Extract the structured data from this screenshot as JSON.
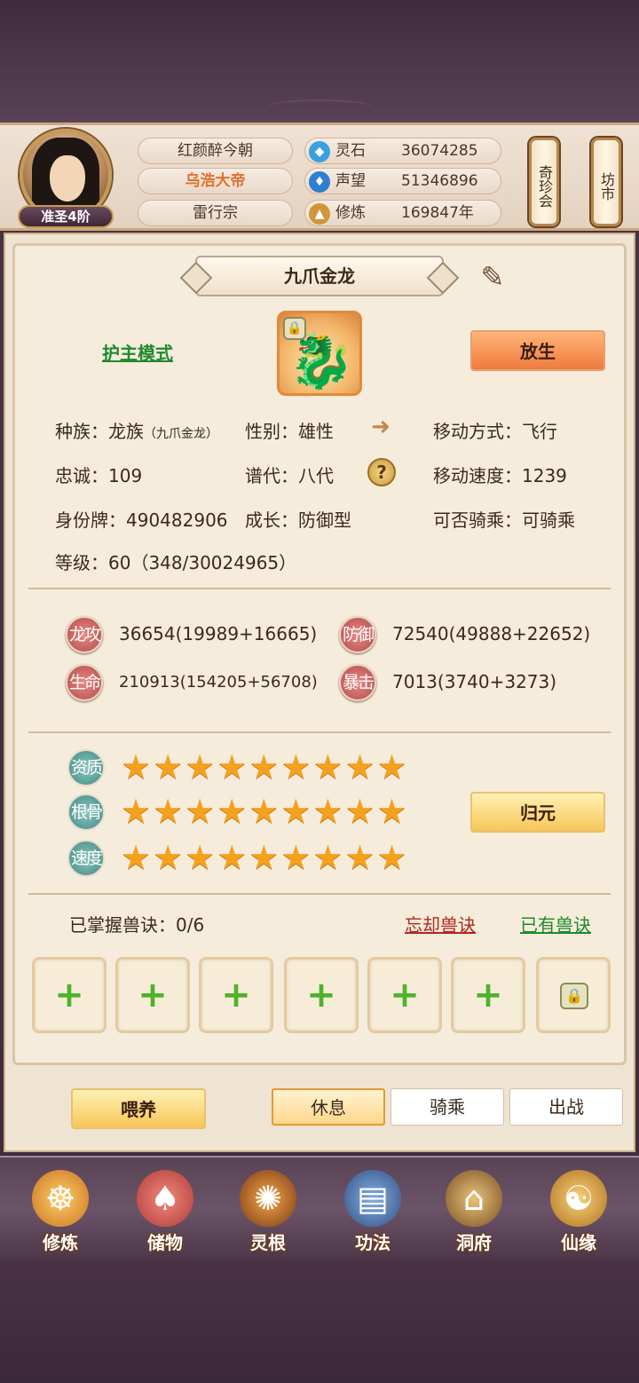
{
  "header": {
    "rank": "准圣4阶",
    "names": [
      "红颜醉今朝",
      "乌浩大帝",
      "雷行宗"
    ],
    "resources": [
      {
        "icon": "spirit-stone-icon",
        "label": "灵石",
        "value": "36074285",
        "color": "#3aa0e0"
      },
      {
        "icon": "reputation-icon",
        "label": "声望",
        "value": "51346896",
        "color": "#2f7fd0"
      },
      {
        "icon": "cultivation-icon",
        "label": "修炼",
        "value": "169847年",
        "color": "#d0963a"
      }
    ],
    "lantern_left": "奇珍会",
    "lantern_right": "坊市"
  },
  "pet": {
    "name": "九爪金龙",
    "guard_mode": "护主模式",
    "release_button": "放生",
    "info": {
      "species_label": "种族：",
      "species": "龙族",
      "species_sub": "（九爪金龙）",
      "gender": "性别：雄性",
      "move_mode": "移动方式：飞行",
      "loyalty": "忠诚：109",
      "generation": "谱代：八代",
      "move_speed": "移动速度：1239",
      "id_tag": "身份牌：490482906",
      "growth": "成长：防御型",
      "rideable": "可否骑乘：可骑乘",
      "level": "等级：60（348/30024965）"
    },
    "stats": [
      {
        "label": "龙攻",
        "value": "36654(19989+16665)"
      },
      {
        "label": "防御",
        "value": "72540(49888+22652)"
      },
      {
        "label": "生命",
        "value": "210913(154205+56708)"
      },
      {
        "label": "暴击",
        "value": "7013(3740+3273)"
      }
    ],
    "qualities": [
      {
        "label": "资质",
        "stars": 9,
        "max": 9
      },
      {
        "label": "根骨",
        "stars": 9,
        "max": 9
      },
      {
        "label": "速度",
        "stars": 9,
        "max": 9
      }
    ],
    "reset_button": "归元",
    "skills": {
      "count": "已掌握兽诀：0/6",
      "forget": "忘却兽诀",
      "owned": "已有兽诀",
      "slots": 6
    }
  },
  "actions": {
    "feed": "喂养",
    "tabs": [
      "休息",
      "骑乘",
      "出战"
    ],
    "active_tab": 0
  },
  "nav": [
    {
      "label": "修炼",
      "icon": "cultivate-icon"
    },
    {
      "label": "储物",
      "icon": "storage-bag-icon"
    },
    {
      "label": "灵根",
      "icon": "spirit-root-icon"
    },
    {
      "label": "功法",
      "icon": "scripture-book-icon"
    },
    {
      "label": "洞府",
      "icon": "cave-mansion-icon"
    },
    {
      "label": "仙缘",
      "icon": "immortal-fate-icon"
    }
  ]
}
